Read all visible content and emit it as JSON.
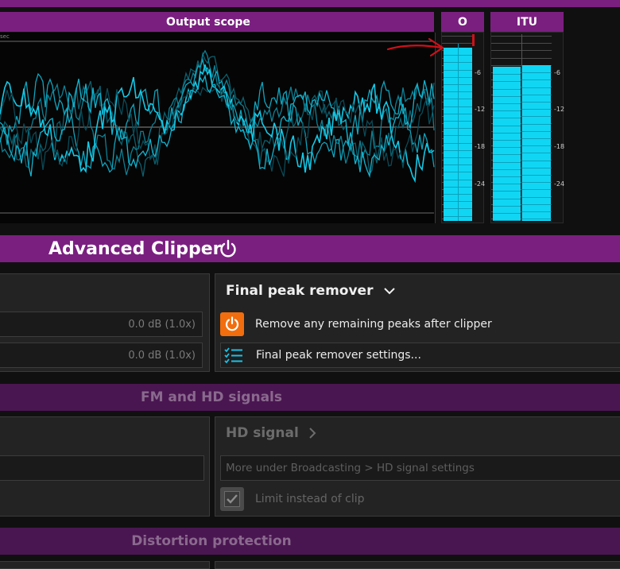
{
  "scope": {
    "title": "Output scope",
    "corner_label": "sec"
  },
  "meters": [
    {
      "title": "O",
      "scale": [
        "-6",
        "-12",
        "-18",
        "-24"
      ],
      "level": 0.92
    },
    {
      "title": "ITU",
      "scale": [
        "-6",
        "-12",
        "-18",
        "-24"
      ],
      "level": 0.82
    }
  ],
  "section": {
    "title": "Advanced Clipper",
    "power_icon": "power-icon"
  },
  "left_fields": [
    "0.0 dB (1.0x)",
    "0.0 dB (1.0x)"
  ],
  "final_peak": {
    "title": "Final peak remover",
    "toggle_label": "Remove any remaining peaks after clipper",
    "settings_label": "Final peak remover settings..."
  },
  "fm_hd": {
    "header": "FM and HD signals",
    "hd_title": "HD signal",
    "hd_link": "More under Broadcasting > HD signal settings",
    "limit_label": "Limit instead of clip"
  },
  "distortion": {
    "header": "Distortion protection"
  },
  "colors": {
    "accent": "#7a1f80",
    "meter": "#10d6f4",
    "power_orange": "#f26d0d",
    "annotation": "#d0101a"
  }
}
